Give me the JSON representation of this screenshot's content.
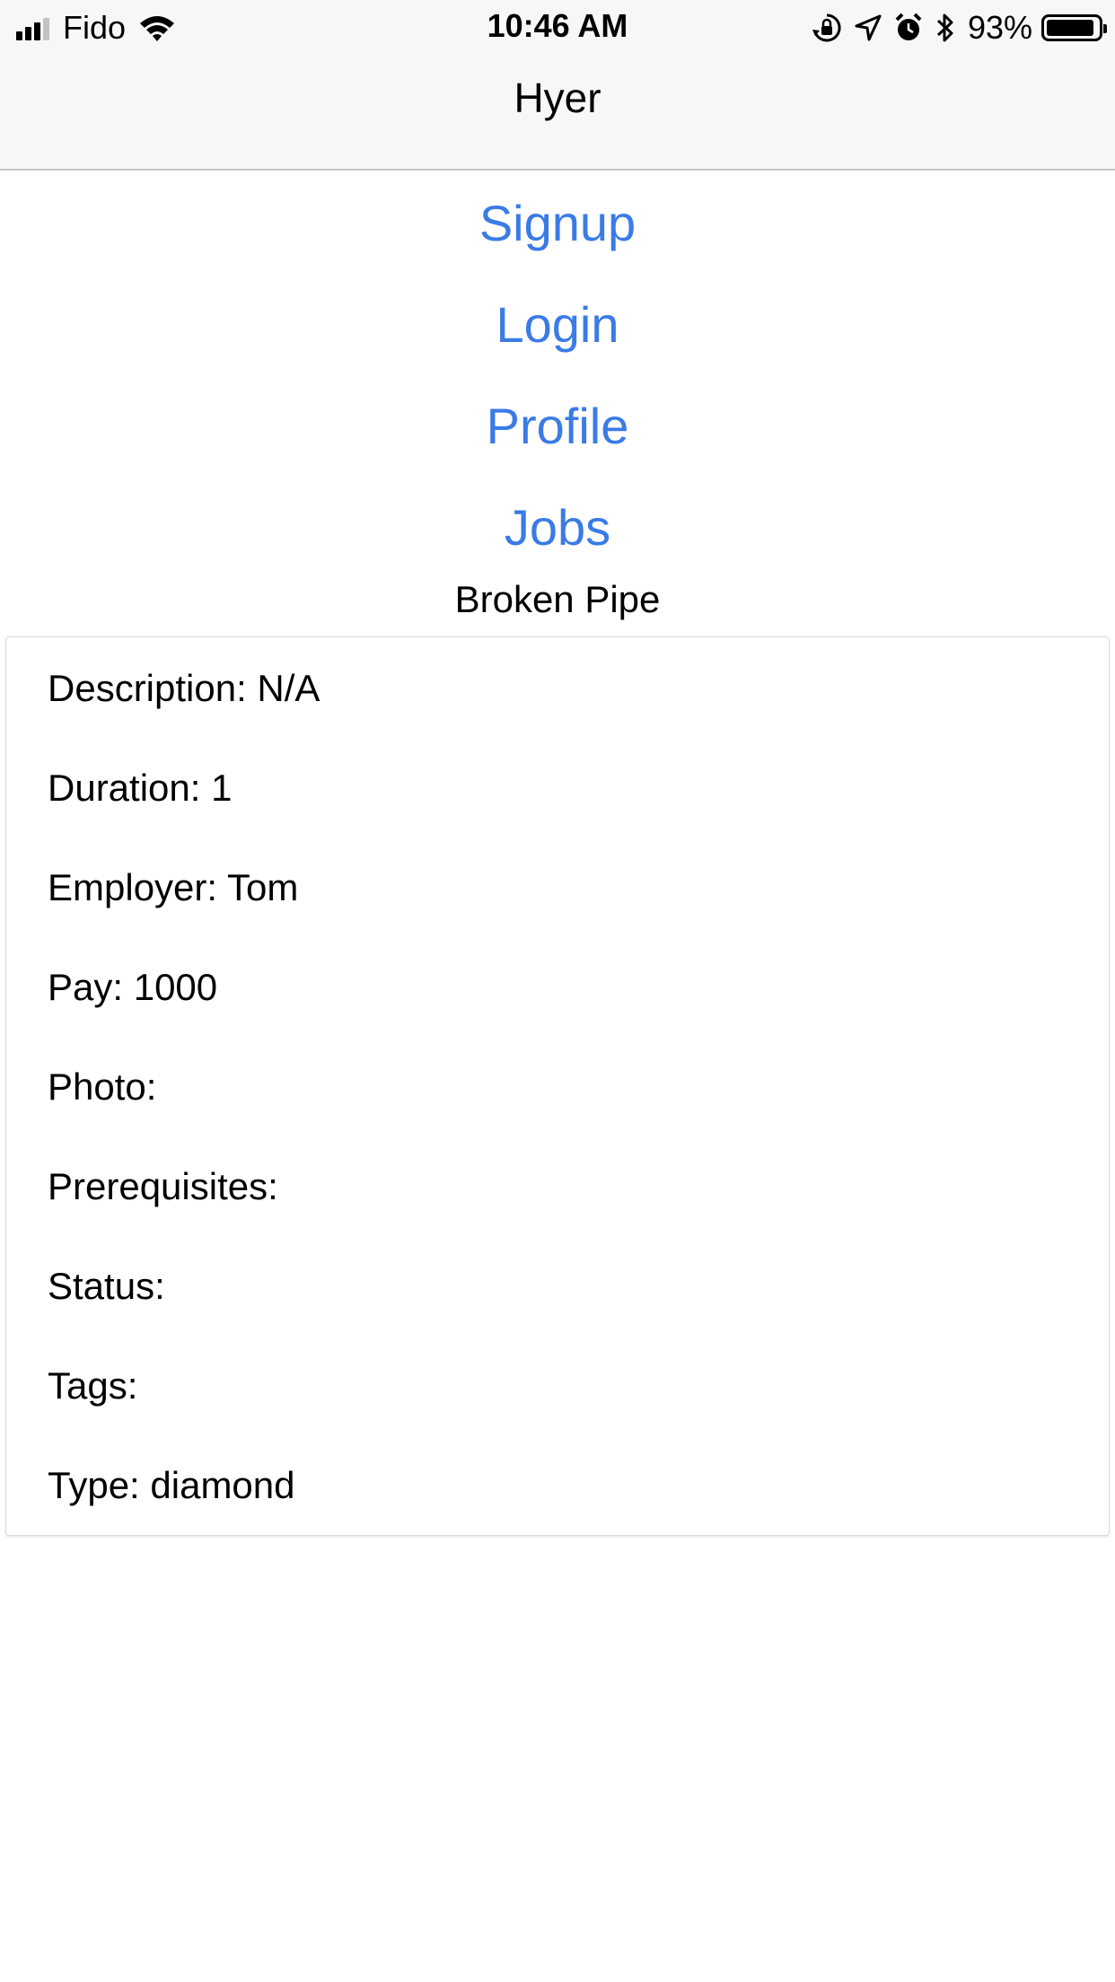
{
  "status_bar": {
    "carrier": "Fido",
    "time": "10:46 AM",
    "battery_percent": "93%",
    "battery_level": 0.93,
    "icons": [
      "signal-icon",
      "wifi-icon",
      "orientation-lock-icon",
      "location-icon",
      "alarm-icon",
      "bluetooth-icon",
      "battery-icon"
    ]
  },
  "nav": {
    "title": "Hyer"
  },
  "menu": {
    "signup": "Signup",
    "login": "Login",
    "profile": "Profile",
    "jobs": "Jobs"
  },
  "job": {
    "title": "Broken Pipe",
    "fields": [
      "Description: N/A",
      "Duration: 1",
      "Employer: Tom",
      "Pay: 1000",
      "Photo:",
      "Prerequisites:",
      "Status:",
      "Tags:",
      "Type: diamond"
    ]
  },
  "colors": {
    "link": "#3a7be6",
    "bar_background": "#f7f7f7"
  }
}
